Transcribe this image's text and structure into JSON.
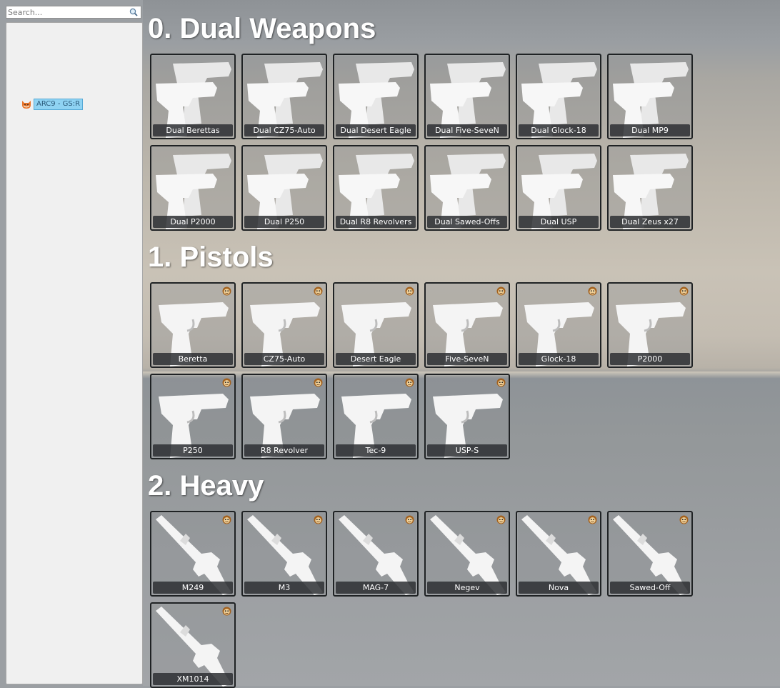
{
  "search": {
    "placeholder": "Search...",
    "icon": "magnifier-icon"
  },
  "tree": {
    "node_label": "ARC9 - GS:R",
    "node_icon": "fox-icon"
  },
  "colors": {
    "node_bg": "#8fd3f3",
    "label_bg": "#2d2f32",
    "title": "#ffffff"
  },
  "sections": [
    {
      "title": "0. Dual Weapons",
      "items": [
        "Dual Berettas",
        "Dual CZ75-Auto",
        "Dual Desert Eagle",
        "Dual Five-SeveN",
        "Dual Glock-18",
        "Dual MP9",
        "Dual P2000",
        "Dual P250",
        "Dual R8 Revolvers",
        "Dual Sawed-Offs",
        "Dual USP",
        "Dual Zeus x27"
      ]
    },
    {
      "title": "1. Pistols",
      "items": [
        "Beretta",
        "CZ75-Auto",
        "Desert Eagle",
        "Five-SeveN",
        "Glock-18",
        "P2000",
        "P250",
        "R8 Revolver",
        "Tec-9",
        "USP-S"
      ]
    },
    {
      "title": "2. Heavy",
      "items": [
        "M249",
        "M3",
        "MAG-7",
        "Negev",
        "Nova",
        "Sawed-Off",
        "XM1014"
      ]
    }
  ]
}
